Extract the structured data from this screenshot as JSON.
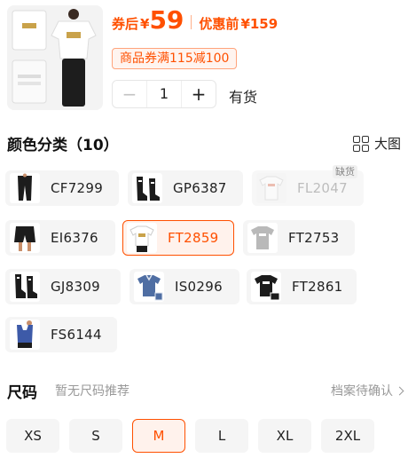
{
  "header": {
    "coupon_prefix": "券后",
    "currency": "¥",
    "coupon_price": "59",
    "orig_label": "优惠前",
    "orig_price": "¥159",
    "coupon_tag": "商品券满115减100",
    "quantity": "1",
    "minus": "−",
    "plus": "+",
    "stock_status": "有货"
  },
  "colors": {
    "title": "颜色分类（10）",
    "view_toggle_label": "大图",
    "soldout_label": "缺货",
    "items": [
      {
        "code": "CF7299",
        "icon": "black-tights-thumb",
        "state": "normal"
      },
      {
        "code": "GP6387",
        "icon": "black-socks-thumb",
        "state": "normal"
      },
      {
        "code": "FL2047",
        "icon": "white-tee-thumb",
        "state": "disabled"
      },
      {
        "code": "EI6376",
        "icon": "black-shorts-thumb",
        "state": "normal"
      },
      {
        "code": "FT2859",
        "icon": "white-tee-gold-thumb",
        "state": "selected"
      },
      {
        "code": "FT2753",
        "icon": "grey-tee-thumb",
        "state": "normal"
      },
      {
        "code": "GJ8309",
        "icon": "black-socks-thumb",
        "state": "normal"
      },
      {
        "code": "IS0296",
        "icon": "blue-polo-thumb",
        "state": "normal"
      },
      {
        "code": "FT2861",
        "icon": "black-tee-thumb",
        "state": "normal"
      },
      {
        "code": "FS6144",
        "icon": "blue-tank-thumb",
        "state": "normal"
      }
    ]
  },
  "size": {
    "title": "尺码",
    "hint": "暂无尺码推荐",
    "record_link": "档案待确认",
    "options": [
      "XS",
      "S",
      "M",
      "L",
      "XL",
      "2XL"
    ],
    "selected": "M"
  },
  "colors_palette": {
    "accent": "#ff5000",
    "chip_bg": "#f5f5f5",
    "selected_bg": "#fff2ec"
  }
}
